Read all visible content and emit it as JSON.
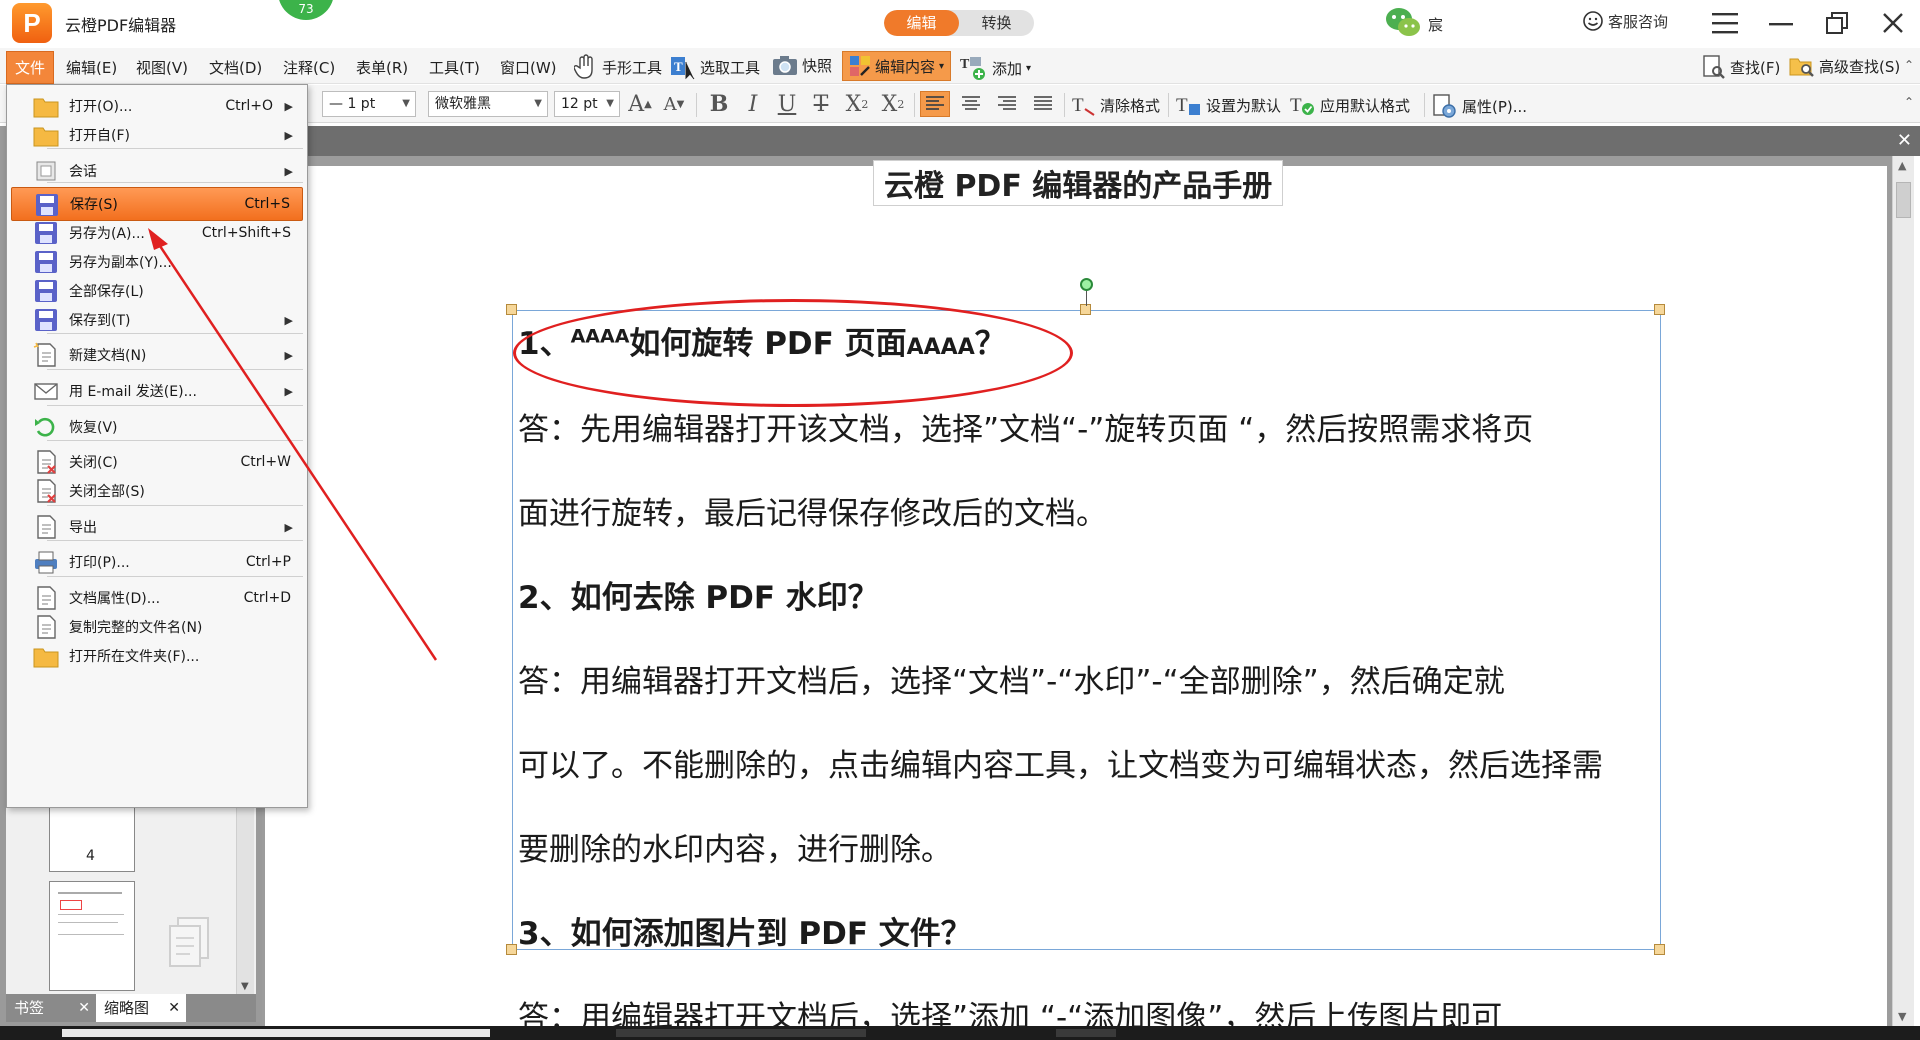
{
  "app": {
    "logo_letter": "P",
    "title": "云橙PDF编辑器",
    "notification_count": "73",
    "mode_tabs": [
      "编辑",
      "转换"
    ],
    "user_name": "宸",
    "support_label": "客服咨询"
  },
  "menubar": {
    "items": [
      "文件",
      "编辑(E)",
      "视图(V)",
      "文档(D)",
      "注释(C)",
      "表单(R)",
      "工具(T)",
      "窗口(W)"
    ],
    "tools": {
      "hand": "手形工具",
      "select": "选取工具",
      "snapshot": "快照",
      "edit_content": "编辑内容",
      "add": "添加",
      "find": "查找(F)",
      "advanced_find": "高级查找(S)"
    }
  },
  "formatbar": {
    "line_width": "— 1 pt",
    "font_name": "微软雅黑",
    "font_size": "12 pt",
    "clear_format": "清除格式",
    "set_default": "设置为默认",
    "apply_default": "应用默认格式",
    "properties": "属性(P)..."
  },
  "file_menu": {
    "items": [
      {
        "label": "打开(O)...",
        "shortcut": "Ctrl+O",
        "submenu": true,
        "icon": "folder-open-icon"
      },
      {
        "label": "打开自(F)",
        "shortcut": "",
        "submenu": true,
        "icon": "folder-globe-icon"
      },
      {
        "label": "会话",
        "shortcut": "",
        "submenu": true,
        "icon": "session-icon"
      },
      {
        "label": "保存(S)",
        "shortcut": "Ctrl+S",
        "submenu": false,
        "icon": "save-icon",
        "active": true
      },
      {
        "label": "另存为(A)...",
        "shortcut": "Ctrl+Shift+S",
        "submenu": false,
        "icon": "save-as-icon"
      },
      {
        "label": "另存为副本(Y)...",
        "shortcut": "",
        "submenu": false,
        "icon": "save-copy-icon"
      },
      {
        "label": "全部保存(L)",
        "shortcut": "",
        "submenu": false,
        "icon": "save-all-icon"
      },
      {
        "label": "保存到(T)",
        "shortcut": "",
        "submenu": true,
        "icon": "save-to-icon"
      },
      {
        "label": "新建文档(N)",
        "shortcut": "",
        "submenu": true,
        "icon": "new-document-icon"
      },
      {
        "label": "用 E-mail 发送(E)...",
        "shortcut": "",
        "submenu": true,
        "icon": "email-icon"
      },
      {
        "label": "恢复(V)",
        "shortcut": "",
        "submenu": false,
        "icon": "restore-icon"
      },
      {
        "label": "关闭(C)",
        "shortcut": "Ctrl+W",
        "submenu": false,
        "icon": "close-document-icon"
      },
      {
        "label": "关闭全部(S)",
        "shortcut": "",
        "submenu": false,
        "icon": "close-all-icon"
      },
      {
        "label": "导出",
        "shortcut": "",
        "submenu": true,
        "icon": "export-icon"
      },
      {
        "label": "打印(P)...",
        "shortcut": "Ctrl+P",
        "submenu": false,
        "icon": "print-icon"
      },
      {
        "label": "文档属性(D)...",
        "shortcut": "Ctrl+D",
        "submenu": false,
        "icon": "document-properties-icon"
      },
      {
        "label": "复制完整的文件名(N)",
        "shortcut": "",
        "submenu": false,
        "icon": "copy-filename-icon"
      },
      {
        "label": "打开所在文件夹(F)...",
        "shortcut": "",
        "submenu": false,
        "icon": "open-folder-icon"
      }
    ]
  },
  "left_panel": {
    "page_label": "4",
    "tabs": [
      "书签",
      "缩略图"
    ]
  },
  "document": {
    "heading": "云橙 PDF 编辑器的产品手册",
    "q1_prefix": "1、",
    "q1_sup": "AAAA",
    "q1_main": "如何旋转 PDF  页面",
    "q1_sub": "AAAA",
    "q1_end": "？",
    "a1_line1": "答：先用编辑器打开该文档，选择”文档“-”旋转页面 “，然后按照需求将页",
    "a1_line2": "面进行旋转，最后记得保存修改后的文档。",
    "q2": "2、如何去除  PDF  水印？",
    "a2_line1": "答：用编辑器打开文档后，选择“文档”-“水印”-“全部删除”，然后确定就",
    "a2_line2": "可以了。不能删除的，点击编辑内容工具，让文档变为可编辑状态，然后选择需",
    "a2_line3": "要删除的水印内容，进行删除。",
    "q3": "3、如何添加图片到  PDF  文件？",
    "a3_line1": "答：用编辑器打开文档后，选择”添加 “-“添加图像”，然后上传图片即可"
  }
}
